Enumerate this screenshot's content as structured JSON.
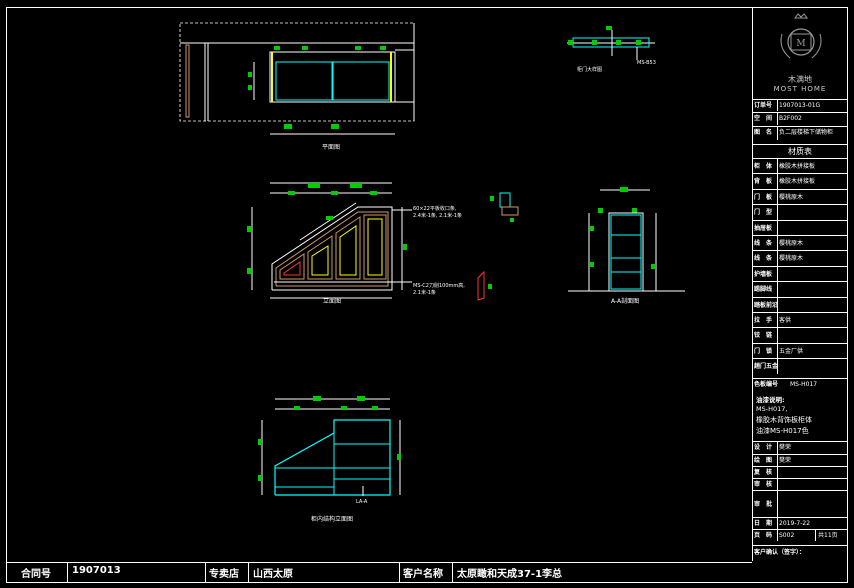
{
  "views": {
    "plan": "平面图",
    "door_sample": "柜门大样图",
    "door_code": "MS-B53",
    "elevation": "立面图",
    "section_aa": "A-A剖面图",
    "inner_structure": "柜内结构立面图",
    "section_marker": "LA-A",
    "note_top_1": "60×22平板收口条,",
    "note_top_2": "2.4米-1条, 2.1米-1条",
    "note_bottom_1": "MS-C2刀削100mm高,",
    "note_bottom_2": "2.1米-1条"
  },
  "titleblock": {
    "logo_cn": "木满地",
    "logo_en": "MOST HOME",
    "order_no_label": "订单号",
    "order_no": "1907013-01G",
    "space_label": "空　间",
    "space": "B2F002",
    "drawing_label": "图　名",
    "drawing_name": "负二层楼梯下储物柜",
    "materials_title": "材质表",
    "rows": [
      {
        "k": "柜　体",
        "v": "橡胶木拼接板"
      },
      {
        "k": "背　板",
        "v": "橡胶木拼接板"
      },
      {
        "k": "门　板",
        "v": "樱桃原木"
      },
      {
        "k": "门　型",
        "v": ""
      },
      {
        "k": "抽屉板",
        "v": ""
      },
      {
        "k": "线　条",
        "v": "樱桃原木"
      },
      {
        "k": "线　条",
        "v": "樱桃原木"
      },
      {
        "k": "护墙板",
        "v": ""
      },
      {
        "k": "踢脚线",
        "v": ""
      },
      {
        "k": "踏板前沿",
        "v": ""
      },
      {
        "k": "拉　手",
        "v": "客供"
      },
      {
        "k": "铰　链",
        "v": ""
      },
      {
        "k": "门　锁",
        "v": "五金厂供"
      },
      {
        "k": "趟门五金",
        "v": ""
      }
    ],
    "color_label": "色板编号",
    "color_code": "MS-H017",
    "note_title": "油漆说明:",
    "note_1": "MS-H017,",
    "note_2": "橡胶木背饰板柜体",
    "note_3": "油漆MS-H017色",
    "designer_label": "设　计",
    "designer": "樊荣",
    "drafter_label": "绘　图",
    "drafter": "樊荣",
    "checker_label": "复　核",
    "checker": "",
    "approver_label": "审　核",
    "approver": "",
    "review_label": "审　批",
    "review": "",
    "date_label": "日　期",
    "date": "2019-7-22",
    "page_label": "页　码",
    "page": "S002",
    "total_pages": "共11页",
    "client_confirm": "客户确认（签字）："
  },
  "bottom": {
    "contract_label": "合同号",
    "contract": "1907013",
    "store_label": "专卖店",
    "store": "山西太原",
    "client_label": "客户名称",
    "client": "太原瞰和天成37-1李总"
  }
}
